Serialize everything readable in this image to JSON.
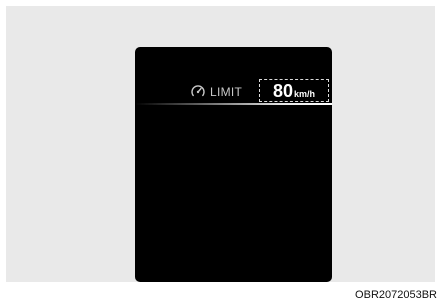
{
  "display": {
    "limit_icon": "speed-limit-icon",
    "limit_label": "LIMIT",
    "speed_value": "80",
    "speed_unit": "km/h",
    "colors": {
      "background": "#e9e9e9",
      "screen": "#000000",
      "text": "#ffffff"
    }
  },
  "caption": "OBR2072053BR"
}
